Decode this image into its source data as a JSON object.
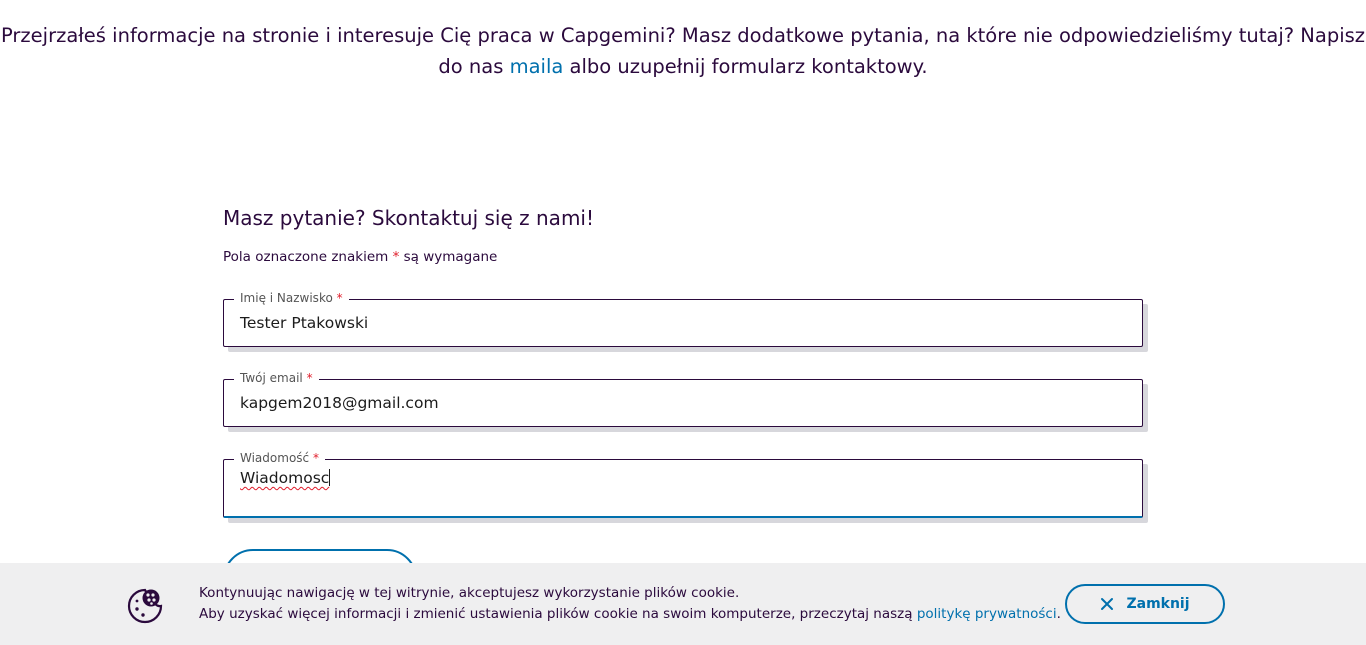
{
  "intro": {
    "text_before": "Przejrzałeś informacje na stronie i interesuje Cię praca w Capgemini? Masz dodatkowe pytania, na które nie odpowiedzieliśmy tutaj? Napisz do nas ",
    "link_label": "maila",
    "text_after": " albo uzupełnij formularz kontaktowy."
  },
  "form": {
    "title": "Masz pytanie? Skontaktuj się z nami!",
    "required_note_before": "Pola oznaczone znakiem ",
    "required_marker": "*",
    "required_note_after": " są wymagane",
    "fields": [
      {
        "label": "Imię i Nazwisko",
        "value": "Tester Ptakowski"
      },
      {
        "label": "Twój email",
        "value": "kapgem2018@gmail.com"
      },
      {
        "label": "Wiadomość",
        "value": "Wiadomosc"
      }
    ]
  },
  "cookie": {
    "line1": "Kontynuując nawigację w tej witrynie, akceptujesz wykorzystanie plików cookie.",
    "line2_before": "Aby uzyskać więcej informacji i zmienić ustawienia plików cookie na swoim komputerze, przeczytaj naszą ",
    "link_label": "politykę prywatności",
    "line2_after": ".",
    "close_label": "Zamknij",
    "icon": "cookie-icon"
  },
  "colors": {
    "text": "#2b0a3d",
    "accent": "#0070ad",
    "required": "#e01c2a",
    "cookie_bar_bg": "#efeff0"
  }
}
